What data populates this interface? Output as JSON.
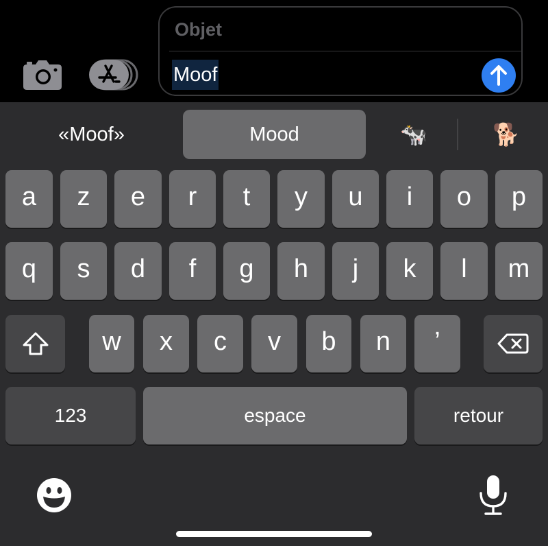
{
  "compose": {
    "subject_placeholder": "Objet",
    "message_text": "Moof",
    "icons": {
      "camera": "camera-icon",
      "apps": "app-store-icon",
      "send": "arrow-up-icon"
    },
    "colors": {
      "send": "#2f7ff1",
      "selection": "#10253f"
    }
  },
  "predictions": {
    "items": [
      "«Moof»",
      "Mood",
      "🐄",
      "🐕"
    ]
  },
  "keyboard": {
    "row1": [
      "a",
      "z",
      "e",
      "r",
      "t",
      "y",
      "u",
      "i",
      "o",
      "p"
    ],
    "row2": [
      "q",
      "s",
      "d",
      "f",
      "g",
      "h",
      "j",
      "k",
      "l",
      "m"
    ],
    "row3": [
      "w",
      "x",
      "c",
      "v",
      "b",
      "n",
      "’"
    ],
    "numbers_label": "123",
    "space_label": "espace",
    "return_label": "retour",
    "icons": {
      "shift": "shift-icon",
      "delete": "backspace-icon",
      "emoji": "emoji-icon",
      "mic": "microphone-icon"
    },
    "colors": {
      "background": "#2c2c2e",
      "key": "#6b6b6d",
      "special_key": "#464648"
    }
  }
}
